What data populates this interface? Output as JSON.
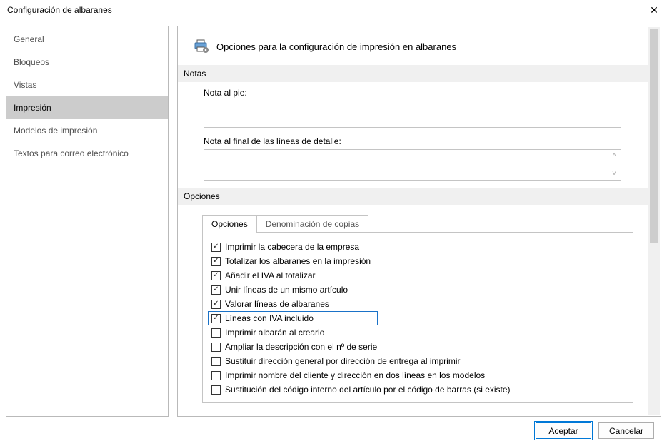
{
  "window": {
    "title": "Configuración de albaranes"
  },
  "sidebar": {
    "items": [
      {
        "label": "General",
        "selected": false
      },
      {
        "label": "Bloqueos",
        "selected": false
      },
      {
        "label": "Vistas",
        "selected": false
      },
      {
        "label": "Impresión",
        "selected": true
      },
      {
        "label": "Modelos de impresión",
        "selected": false
      },
      {
        "label": "Textos para correo electrónico",
        "selected": false
      }
    ]
  },
  "main": {
    "heading": "Opciones para la configuración de impresión en albaranes",
    "sections": {
      "notas": {
        "title": "Notas",
        "fields": {
          "nota_pie": {
            "label": "Nota al pie:",
            "value": ""
          },
          "nota_final": {
            "label": "Nota al final de las líneas de detalle:",
            "value": ""
          }
        }
      },
      "opciones": {
        "title": "Opciones",
        "tabs": [
          {
            "label": "Opciones",
            "active": true
          },
          {
            "label": "Denominación de copias",
            "active": false
          }
        ],
        "checks": [
          {
            "label": "Imprimir la cabecera de la empresa",
            "checked": true,
            "highlight": false
          },
          {
            "label": "Totalizar los albaranes en la impresión",
            "checked": true,
            "highlight": false
          },
          {
            "label": "Añadir el IVA al totalizar",
            "checked": true,
            "highlight": false
          },
          {
            "label": "Unir líneas de un mismo artículo",
            "checked": true,
            "highlight": false
          },
          {
            "label": "Valorar líneas de albaranes",
            "checked": true,
            "highlight": false
          },
          {
            "label": "Líneas con IVA incluido",
            "checked": true,
            "highlight": true
          },
          {
            "label": "Imprimir albarán al crearlo",
            "checked": false,
            "highlight": false
          },
          {
            "label": "Ampliar la descripción con el nº de serie",
            "checked": false,
            "highlight": false
          },
          {
            "label": "Sustituir dirección general por dirección de entrega al imprimir",
            "checked": false,
            "highlight": false
          },
          {
            "label": "Imprimir nombre del cliente y dirección en dos líneas en los modelos",
            "checked": false,
            "highlight": false
          },
          {
            "label": "Sustitución del código interno del artículo por el código de barras (si existe)",
            "checked": false,
            "highlight": false
          }
        ]
      }
    }
  },
  "footer": {
    "accept": "Aceptar",
    "cancel": "Cancelar"
  }
}
